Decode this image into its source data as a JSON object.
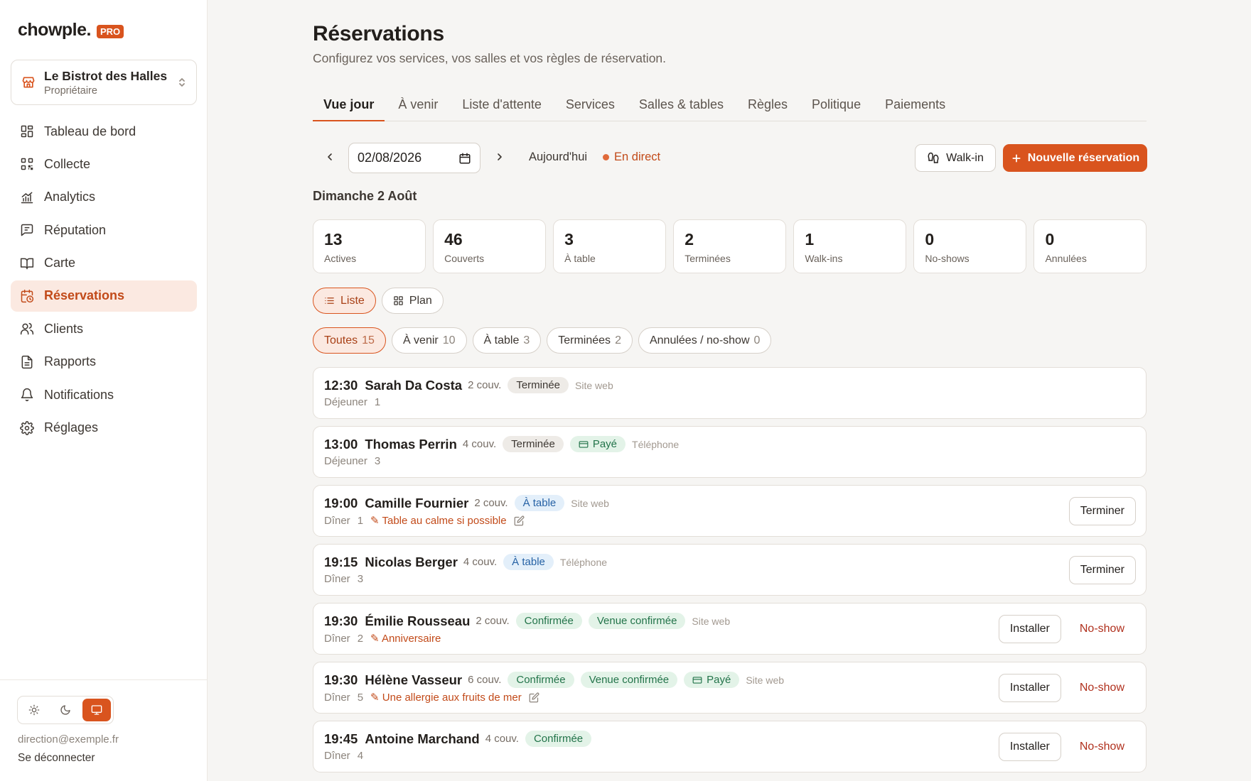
{
  "brand": {
    "name": "chowple.",
    "badge": "PRO"
  },
  "venue": {
    "name": "Le Bistrot des Halles",
    "role": "Propriétaire"
  },
  "nav": [
    {
      "label": "Tableau de bord",
      "icon": "dashboard-icon"
    },
    {
      "label": "Collecte",
      "icon": "qr-code-icon"
    },
    {
      "label": "Analytics",
      "icon": "chart-icon"
    },
    {
      "label": "Réputation",
      "icon": "message-square-icon"
    },
    {
      "label": "Carte",
      "icon": "book-open-icon"
    },
    {
      "label": "Réservations",
      "icon": "calendar-clock-icon",
      "active": true
    },
    {
      "label": "Clients",
      "icon": "users-icon"
    },
    {
      "label": "Rapports",
      "icon": "file-text-icon"
    },
    {
      "label": "Notifications",
      "icon": "bell-icon"
    },
    {
      "label": "Réglages",
      "icon": "gear-icon"
    }
  ],
  "footer": {
    "email": "direction@exemple.fr",
    "logout": "Se déconnecter"
  },
  "page": {
    "title": "Réservations",
    "subtitle": "Configurez vos services, vos salles et vos règles de réservation."
  },
  "tabs": [
    "Vue jour",
    "À venir",
    "Liste d'attente",
    "Services",
    "Salles & tables",
    "Règles",
    "Politique",
    "Paiements"
  ],
  "toolbar": {
    "date": "02/08/2026",
    "today": "Aujourd'hui",
    "live": "En direct",
    "walkin": "Walk-in",
    "new_reservation": "Nouvelle réservation"
  },
  "day_label": "Dimanche 2 Août",
  "stats": [
    {
      "value": "13",
      "label": "Actives"
    },
    {
      "value": "46",
      "label": "Couverts"
    },
    {
      "value": "3",
      "label": "À table"
    },
    {
      "value": "2",
      "label": "Terminées"
    },
    {
      "value": "1",
      "label": "Walk-ins"
    },
    {
      "value": "0",
      "label": "No-shows"
    },
    {
      "value": "0",
      "label": "Annulées"
    }
  ],
  "views": {
    "list": "Liste",
    "plan": "Plan"
  },
  "filters": [
    {
      "label": "Toutes",
      "count": "15"
    },
    {
      "label": "À venir",
      "count": "10"
    },
    {
      "label": "À table",
      "count": "3"
    },
    {
      "label": "Terminées",
      "count": "2"
    },
    {
      "label": "Annulées / no-show",
      "count": "0"
    }
  ],
  "colors": {
    "accent": "#d9541e",
    "accent_soft": "#fbe9e1",
    "atable": "#2662a5",
    "confirmed": "#23744a"
  },
  "reservations": [
    {
      "time": "12:30",
      "name": "Sarah Da Costa",
      "covers": "2 couv.",
      "badges": [
        {
          "label": "Terminée",
          "type": "terminee"
        }
      ],
      "source": "Site web",
      "service": "Déjeuner",
      "table": "1",
      "note": "",
      "note_editable": false,
      "actions": []
    },
    {
      "time": "13:00",
      "name": "Thomas Perrin",
      "covers": "4 couv.",
      "badges": [
        {
          "label": "Terminée",
          "type": "terminee"
        },
        {
          "label": "Payé",
          "type": "paye"
        }
      ],
      "source": "Téléphone",
      "service": "Déjeuner",
      "table": "3",
      "note": "",
      "note_editable": false,
      "actions": []
    },
    {
      "time": "19:00",
      "name": "Camille Fournier",
      "covers": "2 couv.",
      "badges": [
        {
          "label": "À table",
          "type": "atable"
        }
      ],
      "source": "Site web",
      "service": "Dîner",
      "table": "1",
      "note": "✎ Table au calme si possible",
      "note_editable": true,
      "actions": [
        {
          "label": "Terminer",
          "type": "outline"
        }
      ]
    },
    {
      "time": "19:15",
      "name": "Nicolas Berger",
      "covers": "4 couv.",
      "badges": [
        {
          "label": "À table",
          "type": "atable"
        }
      ],
      "source": "Téléphone",
      "service": "Dîner",
      "table": "3",
      "note": "",
      "note_editable": false,
      "actions": [
        {
          "label": "Terminer",
          "type": "outline"
        }
      ]
    },
    {
      "time": "19:30",
      "name": "Émilie Rousseau",
      "covers": "2 couv.",
      "badges": [
        {
          "label": "Confirmée",
          "type": "confirmee"
        },
        {
          "label": "Venue confirmée",
          "type": "venue"
        }
      ],
      "source": "Site web",
      "service": "Dîner",
      "table": "2",
      "note": "✎ Anniversaire",
      "note_editable": false,
      "actions": [
        {
          "label": "Installer",
          "type": "outline"
        },
        {
          "label": "No-show",
          "type": "noshow"
        }
      ]
    },
    {
      "time": "19:30",
      "name": "Hélène Vasseur",
      "covers": "6 couv.",
      "badges": [
        {
          "label": "Confirmée",
          "type": "confirmee"
        },
        {
          "label": "Venue confirmée",
          "type": "venue"
        },
        {
          "label": "Payé",
          "type": "paye"
        }
      ],
      "source": "Site web",
      "service": "Dîner",
      "table": "5",
      "note": "✎ Une allergie aux fruits de mer",
      "note_editable": true,
      "actions": [
        {
          "label": "Installer",
          "type": "outline"
        },
        {
          "label": "No-show",
          "type": "noshow"
        }
      ]
    },
    {
      "time": "19:45",
      "name": "Antoine Marchand",
      "covers": "4 couv.",
      "badges": [
        {
          "label": "Confirmée",
          "type": "confirmee"
        }
      ],
      "source": "",
      "service": "Dîner",
      "table": "4",
      "note": "",
      "note_editable": false,
      "actions": [
        {
          "label": "Installer",
          "type": "outline"
        },
        {
          "label": "No-show",
          "type": "noshow"
        }
      ]
    }
  ]
}
